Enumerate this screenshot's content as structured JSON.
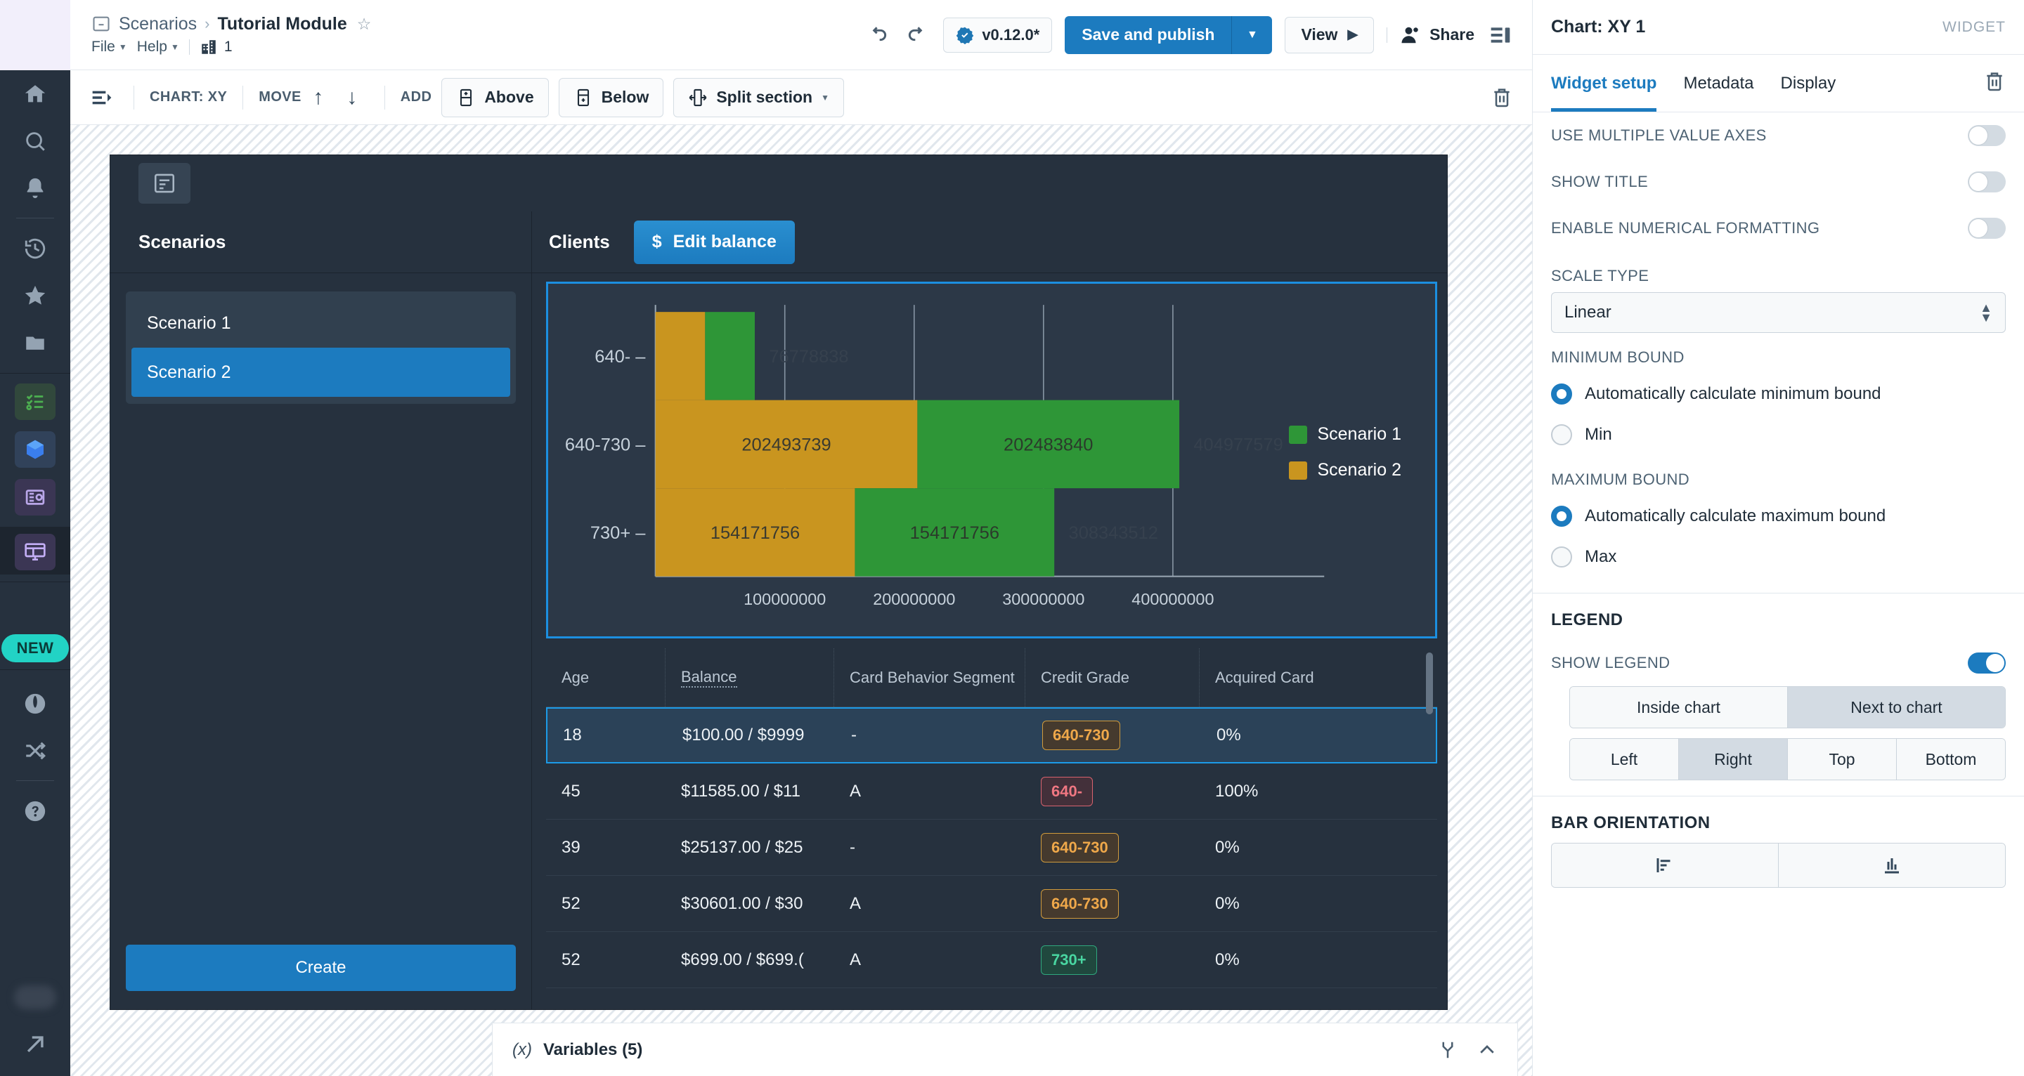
{
  "header": {
    "breadcrumb_parent": "Scenarios",
    "breadcrumb_sep": "›",
    "breadcrumb_title": "Tutorial Module",
    "star": "☆",
    "menu": [
      "File",
      "Help"
    ],
    "building_count": "1",
    "version_label": "v0.12.0*",
    "save_label": "Save and publish",
    "view_label": "View",
    "share_label": "Share"
  },
  "chart_toolbar": {
    "widget_kind": "CHART: XY",
    "move_label": "MOVE",
    "add_label": "ADD",
    "above_label": "Above",
    "below_label": "Below",
    "split_label": "Split section"
  },
  "board": {
    "scenarios_title": "Scenarios",
    "scenarios": [
      {
        "label": "Scenario 1",
        "selected": false
      },
      {
        "label": "Scenario 2",
        "selected": true
      }
    ],
    "create_label": "Create",
    "clients_tab": "Clients",
    "edit_balance_label": "Edit balance",
    "dollar_glyph": "$"
  },
  "chart_data": {
    "type": "bar",
    "orientation": "horizontal",
    "stacked": true,
    "title": "",
    "xlabel": "",
    "ylabel": "",
    "categories": [
      "640-",
      "640-730",
      "730+"
    ],
    "series": [
      {
        "name": "Scenario 2",
        "color": "#C9951F",
        "values": [
          38389419,
          202493739,
          154171756
        ]
      },
      {
        "name": "Scenario 1",
        "color": "#2E9637",
        "values": [
          38389419,
          202483840,
          154171756
        ]
      }
    ],
    "bar_labels": [
      {
        "category": "640-",
        "scenario2": "",
        "scenario1": "",
        "total": "76778838"
      },
      {
        "category": "640-730",
        "scenario2": "202493739",
        "scenario1": "202483840",
        "total": "404977579"
      },
      {
        "category": "730+",
        "scenario2": "154171756",
        "scenario1": "154171756",
        "total": "308343512"
      }
    ],
    "xticks": [
      "100000000",
      "200000000",
      "300000000",
      "400000000"
    ],
    "xtick_values": [
      100000000,
      200000000,
      300000000,
      400000000
    ],
    "xlim": [
      0,
      470000000
    ],
    "grid": true,
    "legend_position": "right",
    "legend": [
      "Scenario 1",
      "Scenario 2"
    ]
  },
  "table": {
    "columns": [
      "Age",
      "Balance",
      "Card Behavior Segment",
      "Credit Grade",
      "Acquired Card"
    ],
    "rows": [
      {
        "age": "18",
        "balance": "$100.00 / $9999",
        "segment": "-",
        "grade": "640-730",
        "grade_kind": "mid",
        "acquired": "0%",
        "selected": true
      },
      {
        "age": "45",
        "balance": "$11585.00 / $11",
        "segment": "A",
        "grade": "640-",
        "grade_kind": "low",
        "acquired": "100%",
        "selected": false
      },
      {
        "age": "39",
        "balance": "$25137.00 / $25",
        "segment": "-",
        "grade": "640-730",
        "grade_kind": "mid",
        "acquired": "0%",
        "selected": false
      },
      {
        "age": "52",
        "balance": "$30601.00 / $30",
        "segment": "A",
        "grade": "640-730",
        "grade_kind": "mid",
        "acquired": "0%",
        "selected": false
      },
      {
        "age": "52",
        "balance": "$699.00 / $699.(",
        "segment": "A",
        "grade": "730+",
        "grade_kind": "hi",
        "acquired": "0%",
        "selected": false
      }
    ]
  },
  "variables_bar": {
    "x_glyph": "(x)",
    "label": "Variables (5)"
  },
  "right_panel": {
    "title": "Chart: XY 1",
    "widget_tag": "WIDGET",
    "tabs": [
      {
        "label": "Widget setup",
        "active": true
      },
      {
        "label": "Metadata",
        "active": false
      },
      {
        "label": "Display",
        "active": false
      }
    ],
    "toggles": [
      {
        "label": "USE MULTIPLE VALUE AXES",
        "on": false
      },
      {
        "label": "SHOW TITLE",
        "on": false
      },
      {
        "label": "ENABLE NUMERICAL FORMATTING",
        "on": false
      }
    ],
    "scale_type_label": "SCALE TYPE",
    "scale_type_value": "Linear",
    "minimum_bound_label": "MINIMUM BOUND",
    "min_auto_label": "Automatically calculate minimum bound",
    "min_label": "Min",
    "maximum_bound_label": "MAXIMUM BOUND",
    "max_auto_label": "Automatically calculate maximum bound",
    "max_label": "Max",
    "legend_label": "LEGEND",
    "show_legend_label": "SHOW LEGEND",
    "show_legend_on": true,
    "legend_place": [
      {
        "label": "Inside chart",
        "active": false
      },
      {
        "label": "Next to chart",
        "active": true
      }
    ],
    "legend_side": [
      {
        "label": "Left",
        "active": false
      },
      {
        "label": "Right",
        "active": true
      },
      {
        "label": "Top",
        "active": false
      },
      {
        "label": "Bottom",
        "active": false
      }
    ],
    "bar_orientation_label": "BAR ORIENTATION"
  },
  "rail": {
    "new_badge": "NEW"
  },
  "colors": {
    "accent_blue": "#1C7BBF",
    "series_green": "#2E9637",
    "series_orange": "#C9951F",
    "dark_panel": "#26313E",
    "chart_bg": "#2C3847",
    "select_blue": "#1C9BE8"
  }
}
